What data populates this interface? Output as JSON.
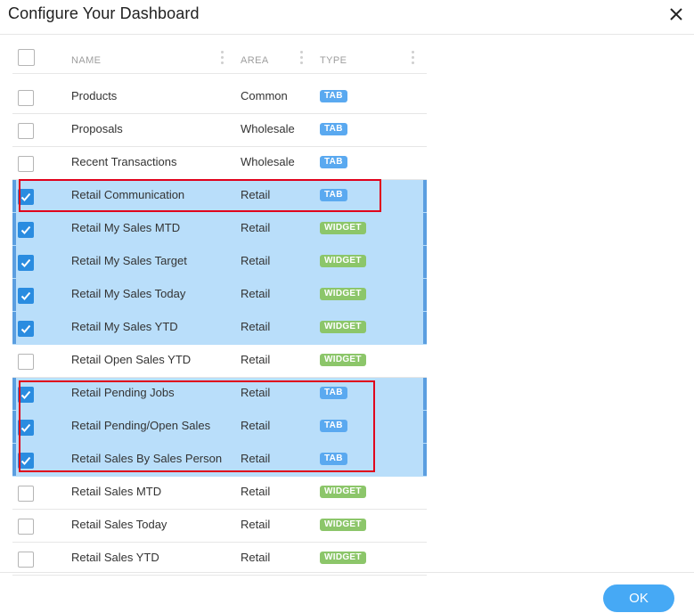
{
  "dialog": {
    "title": "Configure Your Dashboard",
    "ok_label": "OK"
  },
  "columns": {
    "name": "NAME",
    "area": "AREA",
    "type": "TYPE"
  },
  "rows": [
    {
      "name": "Products",
      "area": "Common",
      "type": "TAB",
      "checked": false
    },
    {
      "name": "Proposals",
      "area": "Wholesale",
      "type": "TAB",
      "checked": false
    },
    {
      "name": "Recent Transactions",
      "area": "Wholesale",
      "type": "TAB",
      "checked": false
    },
    {
      "name": "Retail Communication",
      "area": "Retail",
      "type": "TAB",
      "checked": true
    },
    {
      "name": "Retail My Sales MTD",
      "area": "Retail",
      "type": "WIDGET",
      "checked": true
    },
    {
      "name": "Retail My Sales Target",
      "area": "Retail",
      "type": "WIDGET",
      "checked": true
    },
    {
      "name": "Retail My Sales Today",
      "area": "Retail",
      "type": "WIDGET",
      "checked": true
    },
    {
      "name": "Retail My Sales YTD",
      "area": "Retail",
      "type": "WIDGET",
      "checked": true
    },
    {
      "name": "Retail Open Sales YTD",
      "area": "Retail",
      "type": "WIDGET",
      "checked": false
    },
    {
      "name": "Retail Pending Jobs",
      "area": "Retail",
      "type": "TAB",
      "checked": true
    },
    {
      "name": "Retail Pending/Open Sales",
      "area": "Retail",
      "type": "TAB",
      "checked": true
    },
    {
      "name": "Retail Sales By Sales Person",
      "area": "Retail",
      "type": "TAB",
      "checked": true
    },
    {
      "name": "Retail Sales MTD",
      "area": "Retail",
      "type": "WIDGET",
      "checked": false
    },
    {
      "name": "Retail Sales Today",
      "area": "Retail",
      "type": "WIDGET",
      "checked": false
    },
    {
      "name": "Retail Sales YTD",
      "area": "Retail",
      "type": "WIDGET",
      "checked": false
    }
  ],
  "colors": {
    "selected_row": "#b9defa",
    "tab_badge": "#5aa9f0",
    "widget_badge": "#8cc66a",
    "checkbox_checked": "#2a8ce0",
    "highlight_box": "#e0001b",
    "ok_button": "#46a9f5"
  },
  "icons": {
    "close": "close-icon",
    "check": "check-icon"
  }
}
